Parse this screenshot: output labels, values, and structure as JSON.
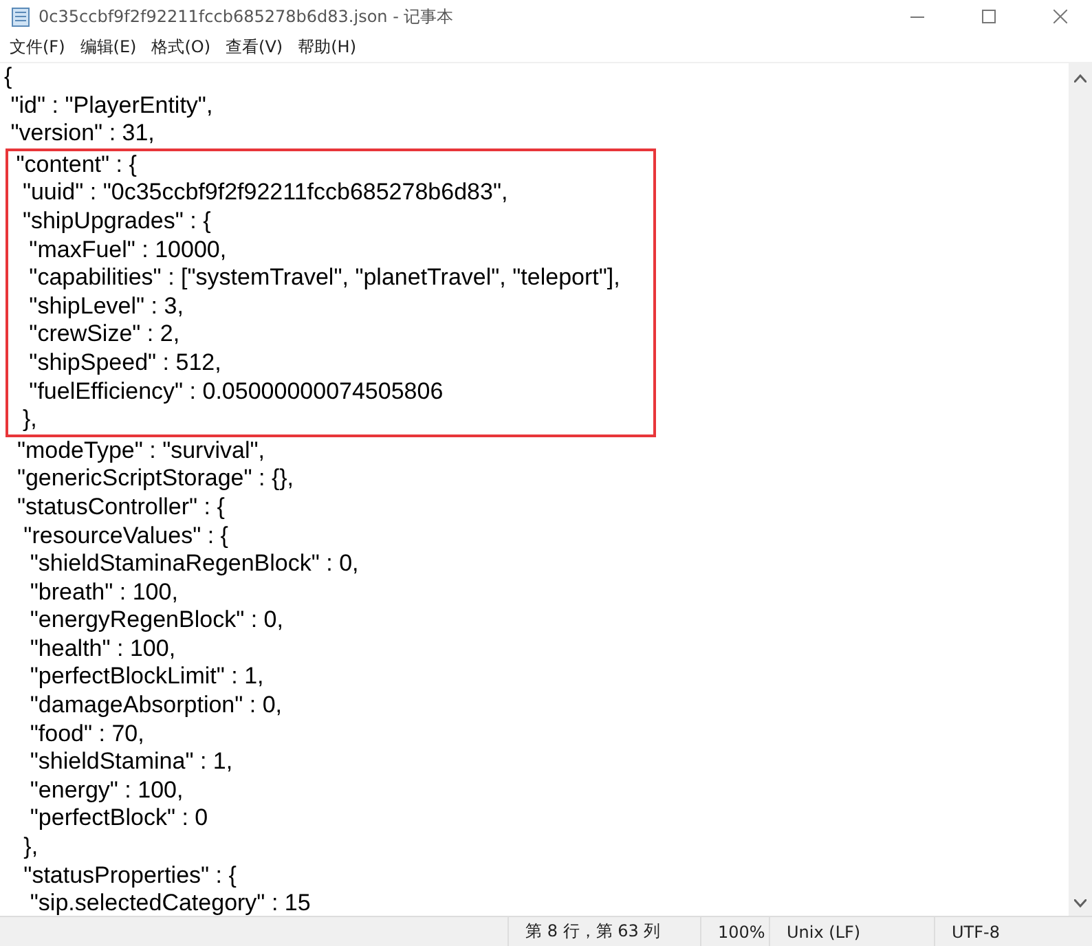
{
  "window": {
    "title": "0c35ccbf9f2f92211fccb685278b6d83.json - 记事本"
  },
  "menu": [
    "文件(F)",
    "编辑(E)",
    "格式(O)",
    "查看(V)",
    "帮助(H)"
  ],
  "editor": {
    "lines_before": [
      "{",
      " \"id\" : \"PlayerEntity\",",
      " \"version\" : 31,"
    ],
    "highlighted_lines": [
      " \"content\" : {",
      "  \"uuid\" : \"0c35ccbf9f2f92211fccb685278b6d83\",",
      "  \"shipUpgrades\" : {",
      "   \"maxFuel\" : 10000,",
      "   \"capabilities\" : [\"systemTravel\", \"planetTravel\", \"teleport\"],",
      "   \"shipLevel\" : 3,",
      "   \"crewSize\" : 2,",
      "   \"shipSpeed\" : 512,",
      "   \"fuelEfficiency\" : 0.05000000074505806",
      "  },"
    ],
    "lines_after": [
      "  \"modeType\" : \"survival\",",
      "  \"genericScriptStorage\" : {},",
      "  \"statusController\" : {",
      "   \"resourceValues\" : {",
      "    \"shieldStaminaRegenBlock\" : 0,",
      "    \"breath\" : 100,",
      "    \"energyRegenBlock\" : 0,",
      "    \"health\" : 100,",
      "    \"perfectBlockLimit\" : 1,",
      "    \"damageAbsorption\" : 0,",
      "    \"food\" : 70,",
      "    \"shieldStamina\" : 1,",
      "    \"energy\" : 100,",
      "    \"perfectBlock\" : 0",
      "   },",
      "   \"statusProperties\" : {",
      "    \"sip.selectedCategory\" : 15"
    ]
  },
  "status_bar": {
    "position": "第 8 行，第 63 列",
    "zoom": "100%",
    "line_ending": "Unix (LF)",
    "encoding": "UTF-8"
  }
}
